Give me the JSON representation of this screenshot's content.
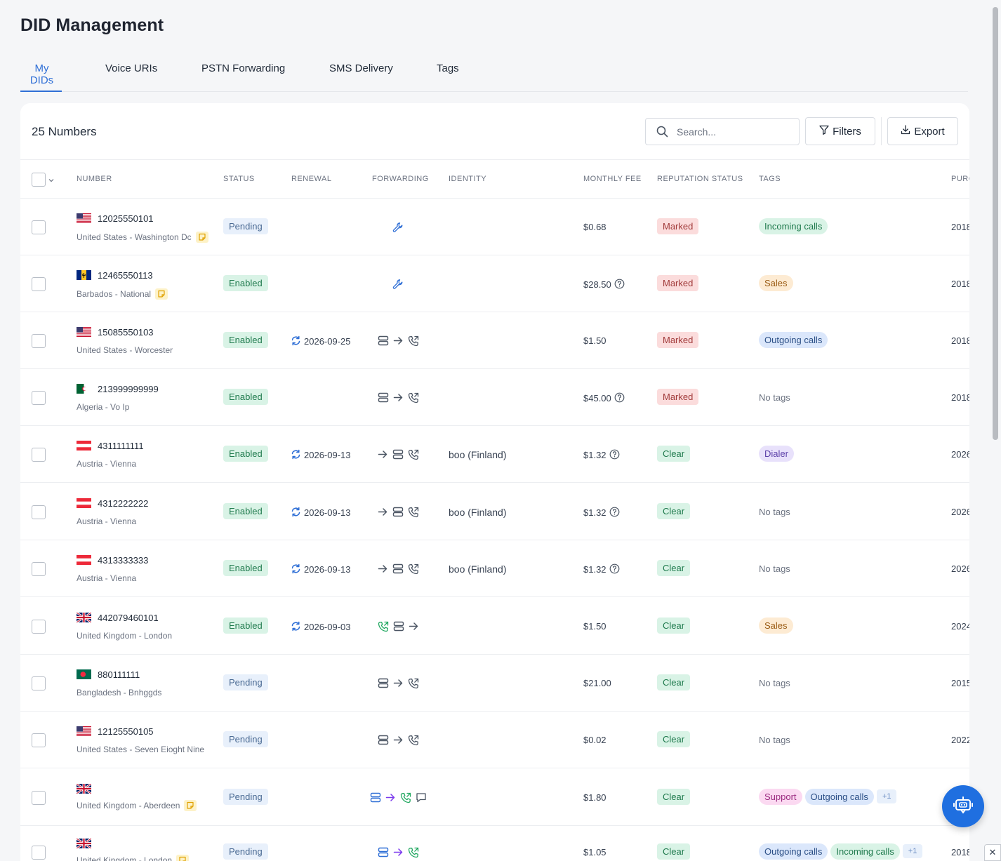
{
  "page_title": "DID Management",
  "tabs": [
    {
      "label": "My DIDs"
    },
    {
      "label": "Voice URIs"
    },
    {
      "label": "PSTN Forwarding"
    },
    {
      "label": "SMS Delivery"
    },
    {
      "label": "Tags"
    }
  ],
  "active_tab": "My DIDs",
  "toolbar": {
    "count_label": "25 Numbers",
    "search_placeholder": "Search...",
    "filters_label": "Filters",
    "export_label": "Export"
  },
  "columns": {
    "number": "NUMBER",
    "status": "STATUS",
    "renewal": "RENEWAL",
    "forwarding": "FORWARDING",
    "identity": "IDENTITY",
    "monthly_fee": "MONTHLY FEE",
    "reputation": "REPUTATION STATUS",
    "tags": "TAGS",
    "purchased": "PURC"
  },
  "colors": {
    "accent": "#2f6fd6",
    "fab": "#1f6fe0",
    "pending": "#e8f0fb",
    "enabled": "#d9f3e6",
    "marked": "#fbdcdc"
  },
  "rows": [
    {
      "number": "12025550101",
      "location": "United States - Washington Dc",
      "note": true,
      "flag": "us",
      "status": "Pending",
      "renewal": "",
      "forwarding": "wrench-icon",
      "identity": "",
      "fee": "$0.68",
      "fee_help": false,
      "reputation": "Marked",
      "tags": [
        "Incoming calls"
      ],
      "no_tags": "",
      "purchased": "2018"
    },
    {
      "number": "12465550113",
      "location": "Barbados - National",
      "note": true,
      "flag": "bb",
      "status": "Enabled",
      "renewal": "",
      "forwarding": "wrench-icon",
      "identity": "",
      "fee": "$28.50",
      "fee_help": true,
      "reputation": "Marked",
      "tags": [
        "Sales"
      ],
      "no_tags": "",
      "purchased": "2018"
    },
    {
      "number": "15085550103",
      "location": "United States - Worcester",
      "note": false,
      "flag": "us",
      "status": "Enabled",
      "renewal": "2026-09-25",
      "forwarding": "server-arrow-phone",
      "identity": "",
      "fee": "$1.50",
      "fee_help": false,
      "reputation": "Marked",
      "tags": [
        "Outgoing calls"
      ],
      "no_tags": "",
      "purchased": "2018"
    },
    {
      "number": "213999999999",
      "location": "Algeria - Vo Ip",
      "note": false,
      "flag": "dz",
      "status": "Enabled",
      "renewal": "",
      "forwarding": "server-arrow-phone",
      "identity": "",
      "fee": "$45.00",
      "fee_help": true,
      "reputation": "Marked",
      "tags": [],
      "no_tags": "No tags",
      "purchased": "2018"
    },
    {
      "number": "4311111111",
      "location": "Austria - Vienna",
      "note": false,
      "flag": "at",
      "status": "Enabled",
      "renewal": "2026-09-13",
      "forwarding": "arrow-server-phone",
      "identity": "boo (Finland)",
      "fee": "$1.32",
      "fee_help": true,
      "reputation": "Clear",
      "tags": [
        "Dialer"
      ],
      "no_tags": "",
      "purchased": "2026"
    },
    {
      "number": "4312222222",
      "location": "Austria - Vienna",
      "note": false,
      "flag": "at",
      "status": "Enabled",
      "renewal": "2026-09-13",
      "forwarding": "arrow-server-phone",
      "identity": "boo (Finland)",
      "fee": "$1.32",
      "fee_help": true,
      "reputation": "Clear",
      "tags": [],
      "no_tags": "No tags",
      "purchased": "2026"
    },
    {
      "number": "4313333333",
      "location": "Austria - Vienna",
      "note": false,
      "flag": "at",
      "status": "Enabled",
      "renewal": "2026-09-13",
      "forwarding": "arrow-server-phone",
      "identity": "boo (Finland)",
      "fee": "$1.32",
      "fee_help": true,
      "reputation": "Clear",
      "tags": [],
      "no_tags": "No tags",
      "purchased": "2026"
    },
    {
      "number": "442079460101",
      "location": "United Kingdom - London",
      "note": false,
      "flag": "gb",
      "status": "Enabled",
      "renewal": "2026-09-03",
      "forwarding": "phone-server-arrow",
      "identity": "",
      "fee": "$1.50",
      "fee_help": false,
      "reputation": "Clear",
      "tags": [
        "Sales"
      ],
      "no_tags": "",
      "purchased": "2024"
    },
    {
      "number": "880111111",
      "location": "Bangladesh - Bnhggds",
      "note": false,
      "flag": "bd",
      "status": "Pending",
      "renewal": "",
      "forwarding": "server-arrow-phone",
      "identity": "",
      "fee": "$21.00",
      "fee_help": false,
      "reputation": "Clear",
      "tags": [],
      "no_tags": "No tags",
      "purchased": "2015"
    },
    {
      "number": "12125550105",
      "location": "United States - Seven Eioght Nine",
      "note": false,
      "flag": "us",
      "status": "Pending",
      "renewal": "",
      "forwarding": "server-arrow-phone",
      "identity": "",
      "fee": "$0.02",
      "fee_help": false,
      "reputation": "Clear",
      "tags": [],
      "no_tags": "No tags",
      "purchased": "2022"
    },
    {
      "number": "",
      "location": "United Kingdom - Aberdeen",
      "note": true,
      "flag": "gb",
      "status": "Pending",
      "renewal": "",
      "forwarding": "server-arrow-phone-chat-colored",
      "identity": "",
      "fee": "$1.80",
      "fee_help": false,
      "reputation": "Clear",
      "tags": [
        "Support",
        "Outgoing calls",
        "+1"
      ],
      "no_tags": "",
      "purchased": ""
    },
    {
      "number": "",
      "location": "United Kingdom - London",
      "note": true,
      "flag": "gb",
      "status": "Pending",
      "renewal": "",
      "forwarding": "server-arrow-phone-colored",
      "identity": "",
      "fee": "$1.05",
      "fee_help": false,
      "reputation": "Clear",
      "tags": [
        "Outgoing calls",
        "Incoming calls",
        "+1"
      ],
      "no_tags": "",
      "purchased": "2018"
    }
  ]
}
